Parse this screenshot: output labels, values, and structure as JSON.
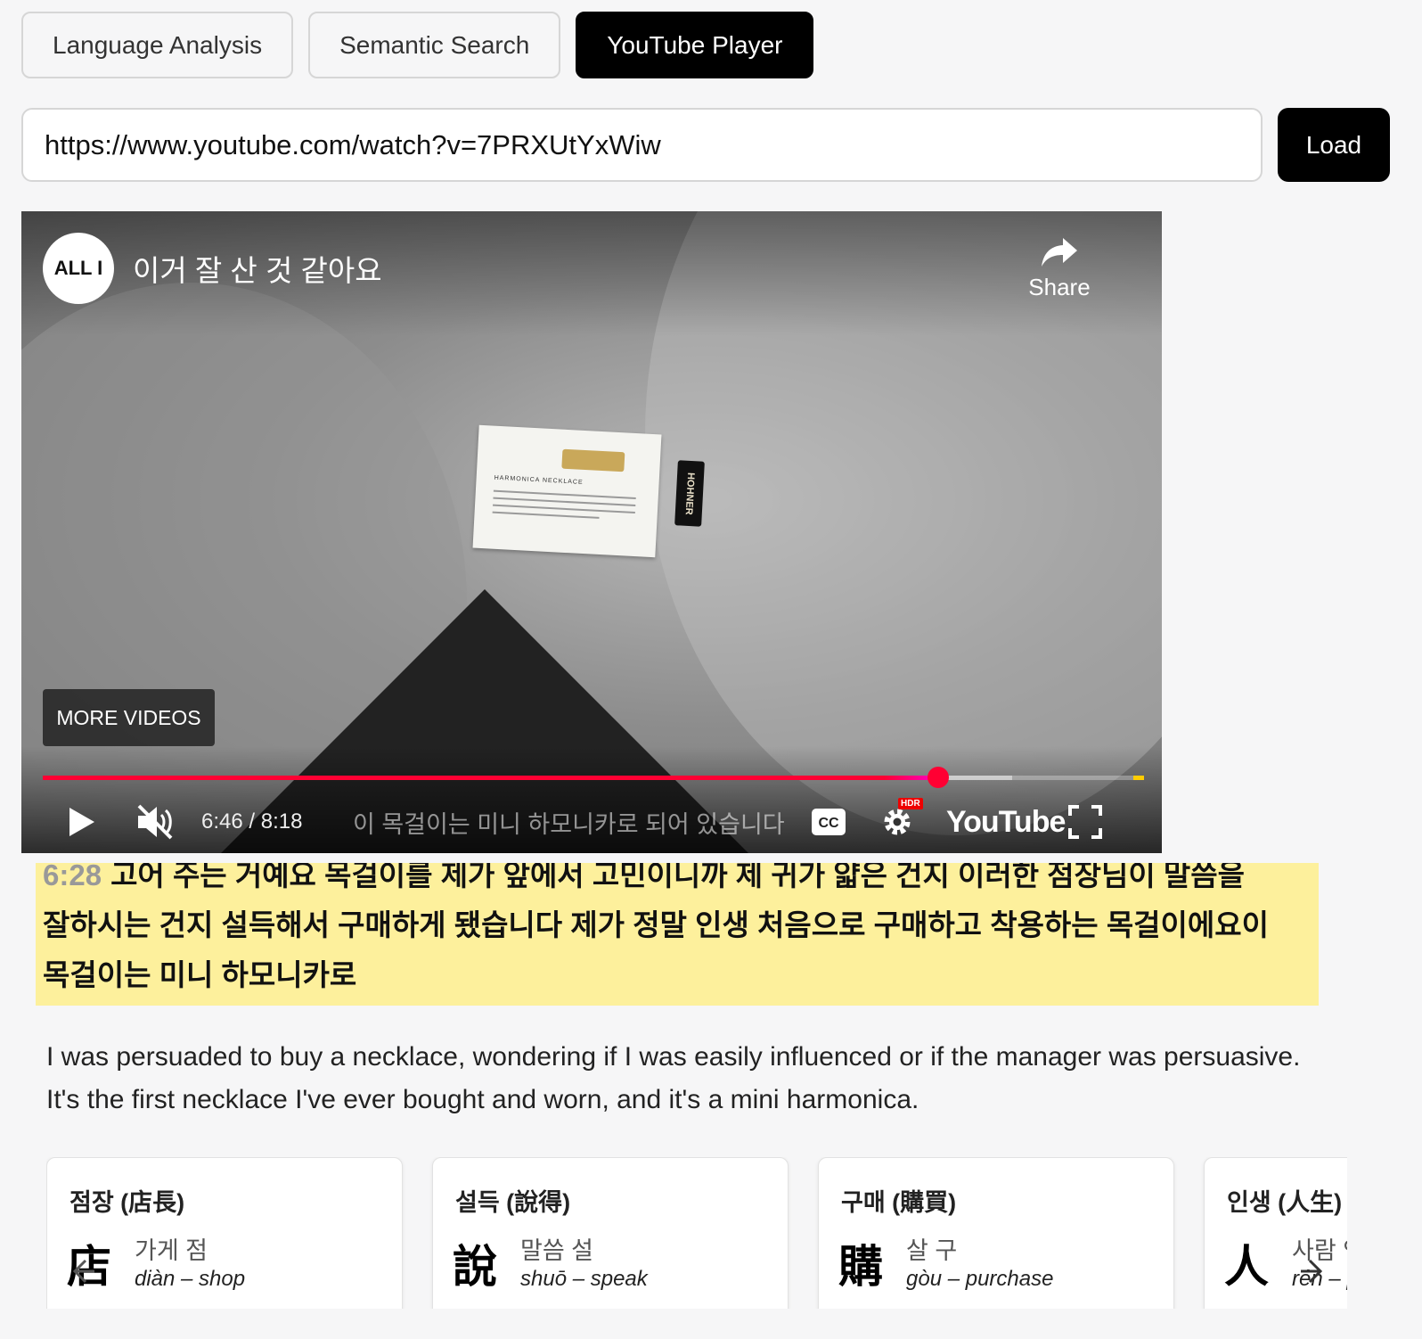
{
  "tabs": [
    {
      "label": "Language Analysis",
      "active": false
    },
    {
      "label": "Semantic Search",
      "active": false
    },
    {
      "label": "YouTube Player",
      "active": true
    }
  ],
  "url_bar": {
    "value": "https://www.youtube.com/watch?v=7PRXUtYxWiw",
    "load_label": "Load"
  },
  "video": {
    "channel_logo_text": "ALL I",
    "title": "이거 잘 산 것 같아요",
    "share_label": "Share",
    "more_videos_label": "MORE VIDEOS",
    "card_heading": "HARMONICA NECKLACE",
    "box_brand": "HOHNER",
    "current_time": "6:46",
    "duration": "8:18",
    "time_display": "6:46 / 8:18",
    "progress_fraction": 0.813,
    "buffer_fraction": 0.88,
    "live_caption": "이 목걸이는 미니 하모니카로 되어 있습니다",
    "hdr_badge": "HDR",
    "youtube_wordmark": "YouTube",
    "muted": true,
    "icons": [
      "share-icon",
      "play-icon",
      "volume-muted-icon",
      "cc-icon",
      "settings-icon",
      "fullscreen-icon"
    ]
  },
  "transcript": {
    "timestamp": "6:28",
    "line1_partial": "고어 주는 거예요 목걸이를 제가 앞에서 고민이니까 제 귀가 얇은 건지 이러한 점장님이 말씀을",
    "line2": "잘하시는 건지 설득해서 구매하게 됐습니다 제가 정말 인생 처음으로 구매하고 착용하는 목걸이에요이",
    "line3": "목걸이는 미니 하모니카로",
    "highlight_color": "#fdf09c"
  },
  "translation": "I was persuaded to buy a necklace, wondering if I was easily influenced or if the manager was persuasive. It's the first necklace I've ever bought and worn, and it's a mini harmonica.",
  "vocab_cards": [
    {
      "title": "점장 (店長)",
      "hanja": "店",
      "meaning": "가게 점",
      "reading": "diàn – shop"
    },
    {
      "title": "설득 (說得)",
      "hanja": "說",
      "meaning": "말씀 설",
      "reading": "shuō – speak"
    },
    {
      "title": "구매 (購買)",
      "hanja": "購",
      "meaning": "살 구",
      "reading": "gòu – purchase"
    },
    {
      "title": "인생 (人生)",
      "hanja": "人",
      "meaning": "사람 인",
      "reading": "rén – person"
    }
  ],
  "carousel": {
    "prev_icon": "chevron-left-icon",
    "next_icon": "chevron-right-icon"
  }
}
